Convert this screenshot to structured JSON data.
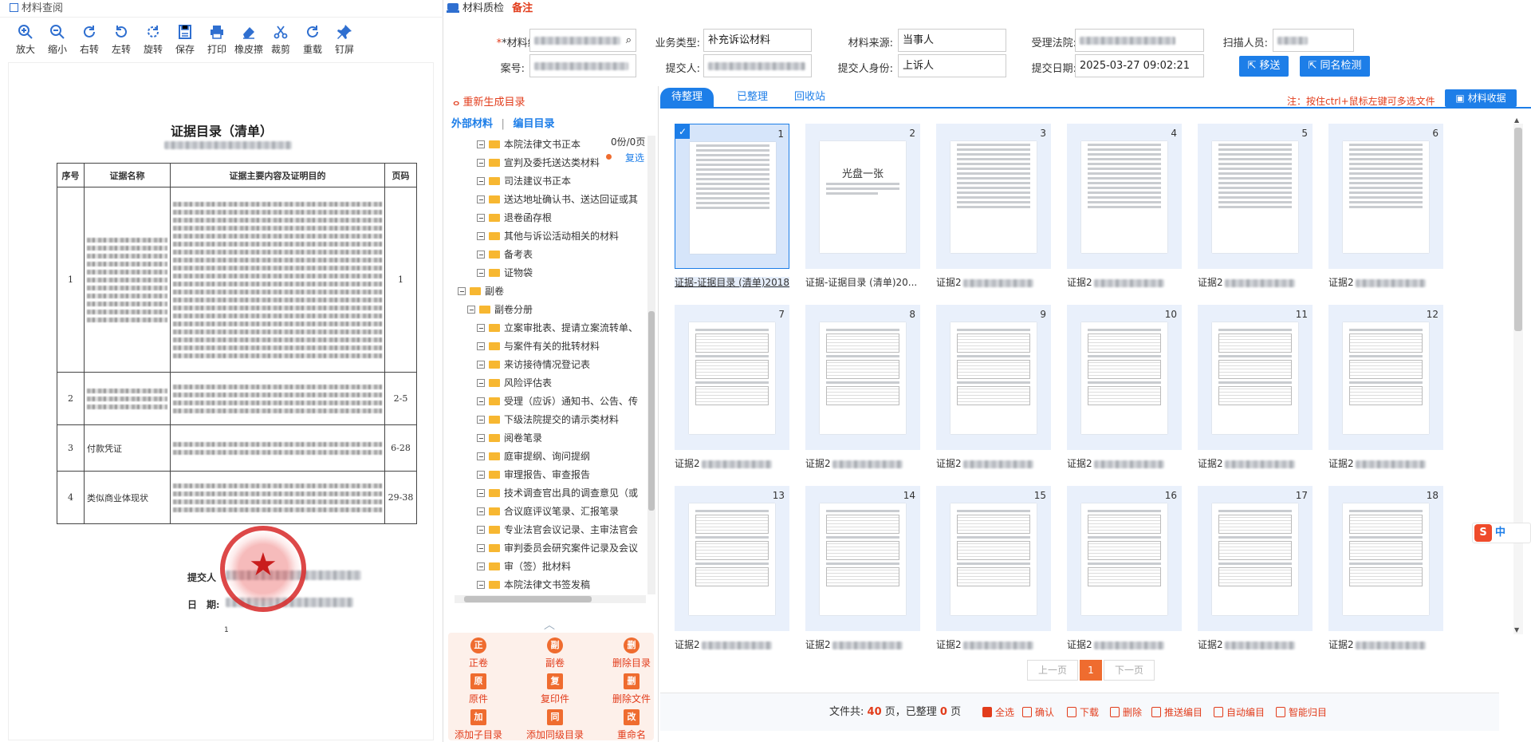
{
  "left": {
    "title": "材料查阅",
    "toolbar": [
      "放大",
      "缩小",
      "右转",
      "左转",
      "旋转",
      "保存",
      "打印",
      "橡皮擦",
      "裁剪",
      "重载",
      "钉屏"
    ],
    "doc": {
      "title": "证据目录（清单）",
      "headers": [
        "序号",
        "证据名称",
        "证据主要内容及证明目的",
        "页码"
      ],
      "rows": [
        {
          "no": "1",
          "name": "",
          "pages": "1"
        },
        {
          "no": "2",
          "name": "",
          "pages": "2-5"
        },
        {
          "no": "3",
          "name": "付款凭证",
          "pages": "6-28"
        },
        {
          "no": "4",
          "name": "类似商业体现状",
          "pages": "29-38"
        }
      ],
      "submitter_label": "提交人",
      "date_label": "日　期:",
      "page_no": "1"
    }
  },
  "right": {
    "title": "材料质检",
    "note": "备注",
    "form": {
      "material_no_label": "*材料编号:",
      "business_type_label": "业务类型:",
      "business_type_value": "补充诉讼材料",
      "source_label": "材料来源:",
      "source_value": "当事人",
      "court_label": "受理法院:",
      "scanner_label": "扫描人员:",
      "case_no_label": "案号:",
      "submitter_label": "提交人:",
      "identity_label": "提交人身份:",
      "identity_value": "上诉人",
      "date_label": "提交日期:",
      "date_value": "2025-03-27 09:02:21",
      "move_button": "移送",
      "check_button": "同名检测"
    },
    "tree_panel": {
      "regen": "重新生成目录",
      "tab_external": "外部材料",
      "tab_sep": "|",
      "tab_catalog": "编目目录",
      "page_count": "0份/0页",
      "copy_select": "复选",
      "items": [
        {
          "label": "本院法律文书正本",
          "level": 2
        },
        {
          "label": "宣判及委托送达类材料",
          "level": 2
        },
        {
          "label": "司法建议书正本",
          "level": 2
        },
        {
          "label": "送达地址确认书、送达回证或其",
          "level": 2
        },
        {
          "label": "退卷函存根",
          "level": 2
        },
        {
          "label": "其他与诉讼活动相关的材料",
          "level": 2
        },
        {
          "label": "备考表",
          "level": 2
        },
        {
          "label": "证物袋",
          "level": 2
        },
        {
          "label": "副卷",
          "level": 0
        },
        {
          "label": "副卷分册",
          "level": 1
        },
        {
          "label": "立案审批表、提请立案流转单、",
          "level": 2
        },
        {
          "label": "与案件有关的批转材料",
          "level": 2
        },
        {
          "label": "来访接待情况登记表",
          "level": 2
        },
        {
          "label": "风险评估表",
          "level": 2
        },
        {
          "label": "受理（应诉）通知书、公告、传",
          "level": 2
        },
        {
          "label": "下级法院提交的请示类材料",
          "level": 2
        },
        {
          "label": "阅卷笔录",
          "level": 2
        },
        {
          "label": "庭审提纲、询问提纲",
          "level": 2
        },
        {
          "label": "审理报告、审查报告",
          "level": 2
        },
        {
          "label": "技术调查官出具的调查意见（或",
          "level": 2
        },
        {
          "label": "合议庭评议笔录、汇报笔录",
          "level": 2
        },
        {
          "label": "专业法官会议记录、主审法官会",
          "level": 2
        },
        {
          "label": "审判委员会研究案件记录及会议",
          "level": 2
        },
        {
          "label": "审（签）批材料",
          "level": 2
        },
        {
          "label": "本院法律文书签发稿",
          "level": 2
        }
      ],
      "actions": [
        {
          "icon": "正",
          "label": "正卷"
        },
        {
          "icon": "副",
          "label": "副卷"
        },
        {
          "icon": "删",
          "label": "删除目录"
        },
        {
          "icon": "原",
          "label": "原件"
        },
        {
          "icon": "复",
          "label": "复印件"
        },
        {
          "icon": "删",
          "label": "删除文件"
        },
        {
          "icon": "加",
          "label": "添加子目录"
        },
        {
          "icon": "同",
          "label": "添加同级目录"
        },
        {
          "icon": "改",
          "label": "重命名"
        }
      ]
    },
    "gallery": {
      "tabs": [
        "待整理",
        "已整理",
        "回收站"
      ],
      "hint": "注：按住ctrl+鼠标左键可多选文件",
      "receive_button": "材料收据",
      "captions": [
        "证据-证据目录 (清单)2018",
        "证据-证据目录 (清单)20...",
        "证据2",
        "证据2",
        "证据2",
        "证据2"
      ],
      "row_caption": "证据2",
      "prev": "上一页",
      "page": "1",
      "next": "下一页",
      "footer": {
        "total_prefix": "文件共:",
        "total": "40",
        "total_unit": "页，已整理",
        "done": "0",
        "done_unit": "页",
        "actions": [
          "全选",
          "确认",
          "下载",
          "删除",
          "推送编目",
          "自动编目",
          "智能归目"
        ]
      }
    },
    "ime": "中"
  }
}
